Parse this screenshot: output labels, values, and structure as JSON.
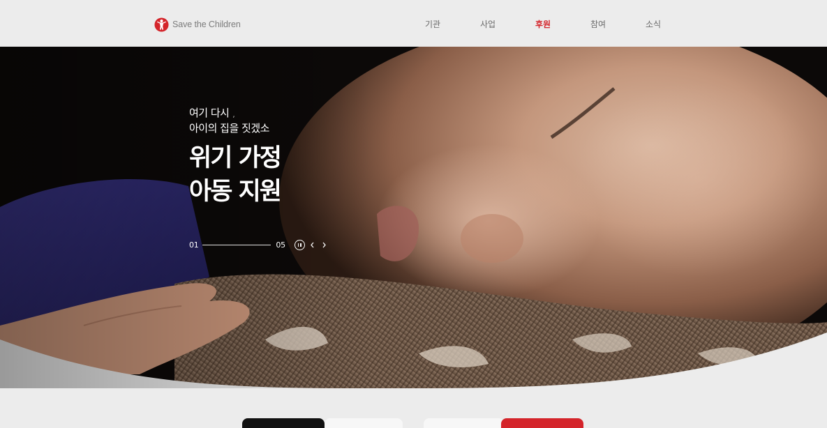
{
  "header": {
    "logo_text": "Save the Children",
    "nav": [
      {
        "label": "기관",
        "active": false
      },
      {
        "label": "사업",
        "active": false
      },
      {
        "label": "후원",
        "active": true
      },
      {
        "label": "참여",
        "active": false
      },
      {
        "label": "소식",
        "active": false
      }
    ]
  },
  "hero": {
    "subtitle_line1": "여기 다시 ,",
    "subtitle_line2": "아이의 집을 짓겠소",
    "title_line1": "위기 가정",
    "title_line2": "아동 지원",
    "slider": {
      "current": "01",
      "total": "05",
      "pause_icon": "pause-icon",
      "prev_icon": "chevron-left-icon",
      "next_icon": "chevron-right-icon"
    }
  },
  "colors": {
    "brand_red": "#d4242a",
    "background": "#ececec",
    "nav_text": "#6a6a6a"
  }
}
